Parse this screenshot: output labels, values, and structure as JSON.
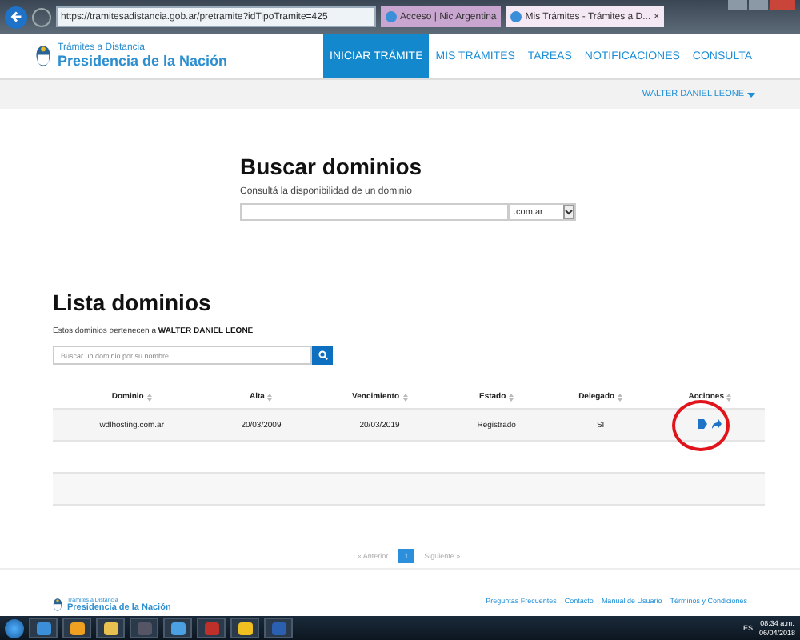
{
  "browser": {
    "address": "https://tramitesadistancia.gob.ar/pretramite?idTipoTramite=425",
    "tabs": [
      {
        "label": "Acceso | Nic Argentina",
        "selected": false
      },
      {
        "label": "Mis Trámites - Trámites a D...",
        "selected": true,
        "close": "×"
      }
    ]
  },
  "header": {
    "logo_line1": "Trámites a Distancia",
    "logo_line2": "Presidencia de la Nación",
    "nav": [
      {
        "label": "INICIAR TRÁMITE",
        "selected": true
      },
      {
        "label": "MIS TRÁMITES",
        "selected": false
      },
      {
        "label": "TAREAS",
        "selected": false
      },
      {
        "label": "NOTIFICACIONES",
        "selected": false
      },
      {
        "label": "CONSULTA",
        "selected": false
      }
    ]
  },
  "user_menu": {
    "name": "WALTER DANIEL LEONE"
  },
  "search_section": {
    "title": "Buscar dominios",
    "subtitle": "Consultá la disponibilidad de un dominio",
    "suffix": ".com.ar"
  },
  "list_section": {
    "title": "Lista dominios",
    "owner_text": "Estos dominios pertenecen a **WALTER DANIEL LEONE**",
    "search_placeholder": "Buscar un dominio por su nombre",
    "table": {
      "columns": [
        "Dominio",
        "Alta",
        "Vencimiento",
        "Estado",
        "Delegado",
        "Acciones"
      ],
      "rows": [
        [
          "wdlhosting.com.ar",
          "20/03/2009",
          "20/03/2019",
          "Registrado",
          "SI"
        ]
      ]
    },
    "pagination": {
      "previous": "« Anterior",
      "pages": [
        {
          "label": "1",
          "selected": true
        }
      ],
      "next": "Siguiente »"
    }
  },
  "footer": {
    "logo_line1": "Trámites a Distancia",
    "logo_line2": "Presidencia de la Nación",
    "links": [
      "Preguntas Frecuentes",
      "Contacto",
      "Manual de Usuario",
      "Términos y Condiciones"
    ]
  },
  "taskbar": {
    "language": "ES",
    "time": "08:34 a.m.",
    "date": "06/04/2018"
  }
}
